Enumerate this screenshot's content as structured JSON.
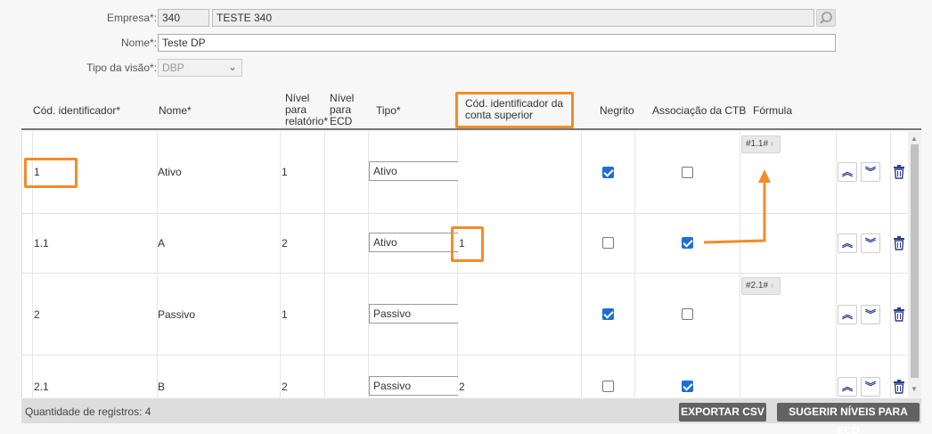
{
  "form": {
    "empresa": {
      "label": "Empresa*:",
      "code": "340",
      "name": "TESTE 340"
    },
    "nome": {
      "label": "Nome*:",
      "value": "Teste DP"
    },
    "tipo_visao": {
      "label": "Tipo da visão*:",
      "value": "DBP"
    }
  },
  "grid": {
    "columns": {
      "cod": "Cód. identificador*",
      "nome": "Nome*",
      "nivel_rel_1": "Nível",
      "nivel_rel_2": "para",
      "nivel_rel_3": "relatório*",
      "nivel_ecd_1": "Nível",
      "nivel_ecd_2": "para",
      "nivel_ecd_3": "ECD",
      "tipo": "Tipo*",
      "cod_sup_1": "Cód. identificador da",
      "cod_sup_2": "conta superior",
      "negrito": "Negrito",
      "assoc": "Associação da CTB",
      "formula": "Fórmula"
    },
    "rows": [
      {
        "cod": "1",
        "nome": "Ativo",
        "nivel": "1",
        "tipo": "Ativo",
        "cod_sup": "",
        "formula": "#1.1#"
      },
      {
        "cod": "1.1",
        "nome": "A",
        "nivel": "2",
        "tipo": "Ativo",
        "cod_sup": "1",
        "formula": ""
      },
      {
        "cod": "2",
        "nome": "Passivo",
        "nivel": "1",
        "tipo": "Passivo",
        "cod_sup": "",
        "formula": "#2.1#"
      },
      {
        "cod": "2.1",
        "nome": "B",
        "nivel": "2",
        "tipo": "Passivo",
        "cod_sup": "2",
        "formula": ""
      }
    ]
  },
  "footer": {
    "count": "Quantidade de registros: 4",
    "export_csv": "EXPORTAR CSV",
    "sugerir": "SUGERIR NÍVEIS PARA ECD"
  },
  "colors": {
    "highlight": "#f28c28",
    "checkbox": "#1f6fd1",
    "button": "#626262"
  }
}
